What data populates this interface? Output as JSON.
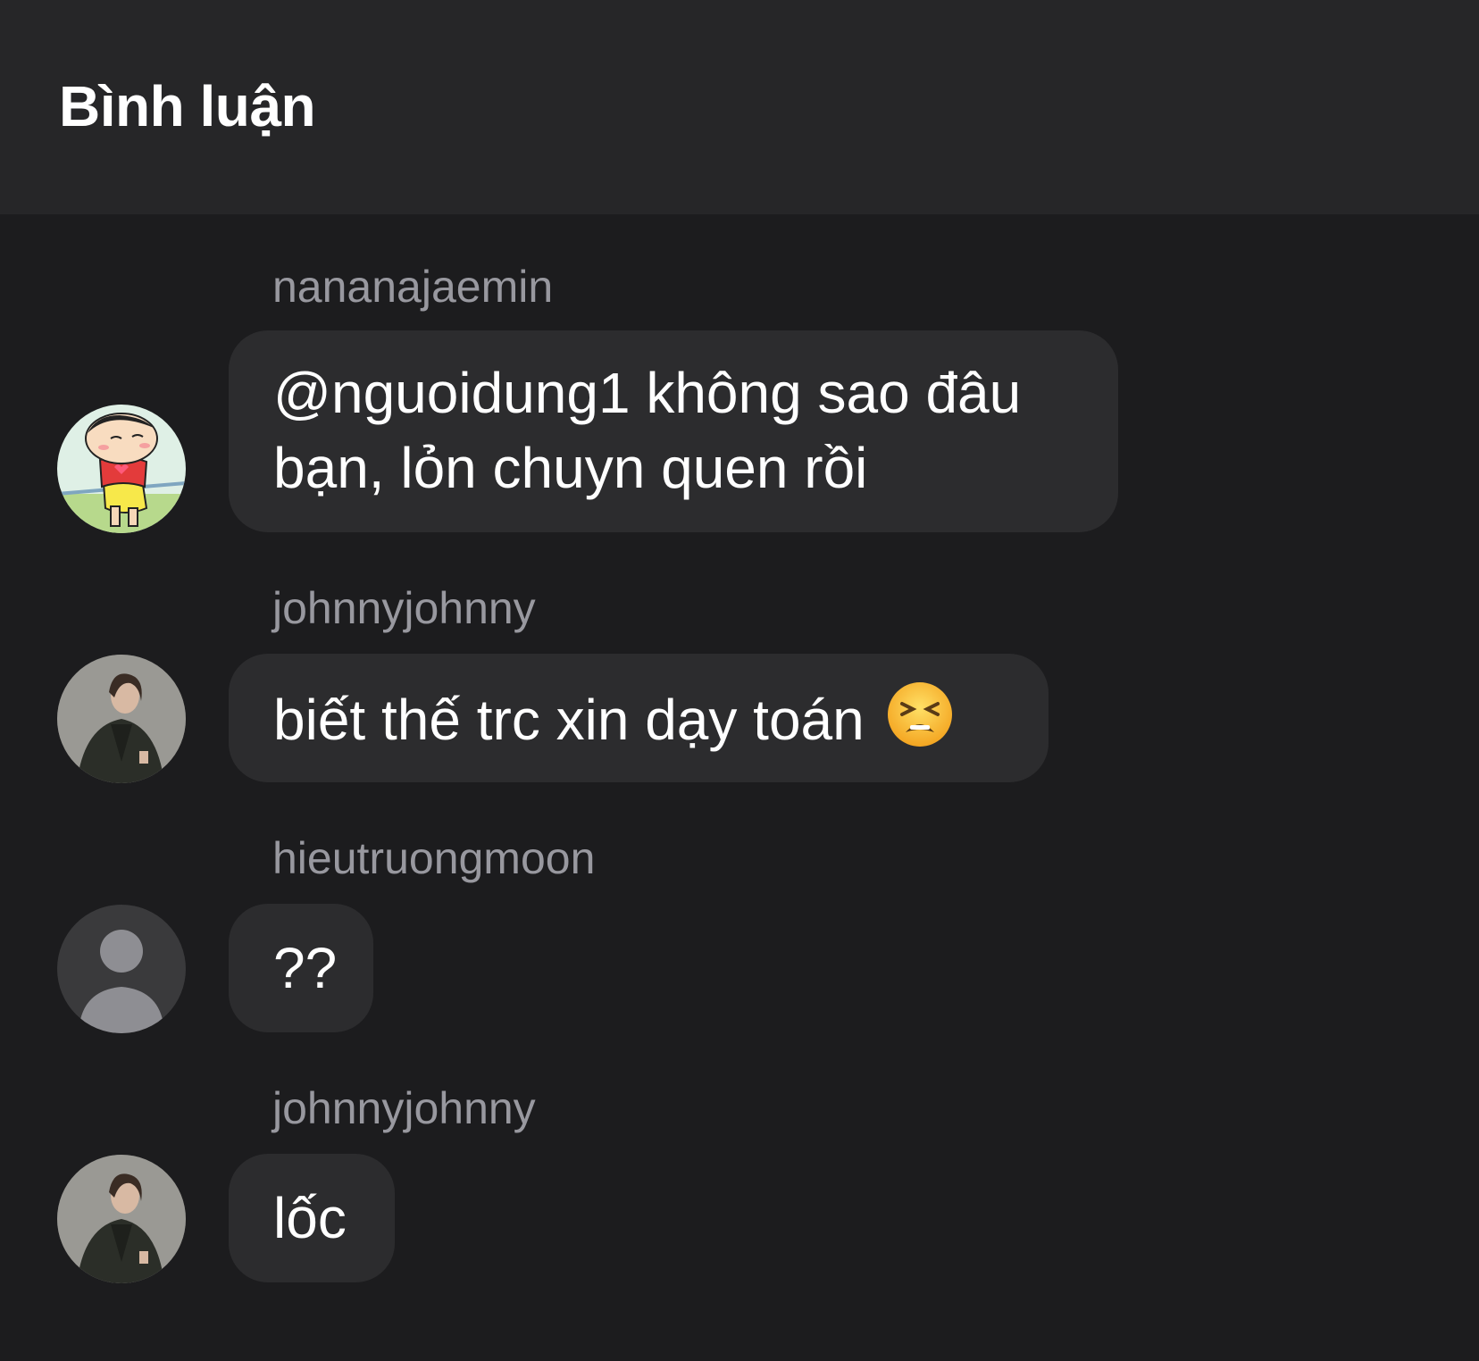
{
  "header": {
    "title": "Bình luận"
  },
  "comments": [
    {
      "username": "nananajaemin",
      "text": "@nguoidung1 không sao đâu bạn, lỏn chuyn quen rồi",
      "avatar": "cartoon-avatar"
    },
    {
      "username": "johnnyjohnny",
      "text": "biết thế trc xin dạy toán",
      "emoji": "tired-face-emoji",
      "avatar": "person-photo-avatar"
    },
    {
      "username": "hieutruongmoon",
      "text": "??",
      "avatar": "default-user-avatar"
    },
    {
      "username": "johnnyjohnny",
      "text": "lốc",
      "avatar": "person-photo-avatar"
    }
  ],
  "colors": {
    "background": "#1c1c1e",
    "header": "#262628",
    "bubble": "#2c2c2e",
    "username": "#98989f",
    "text": "#ffffff"
  }
}
